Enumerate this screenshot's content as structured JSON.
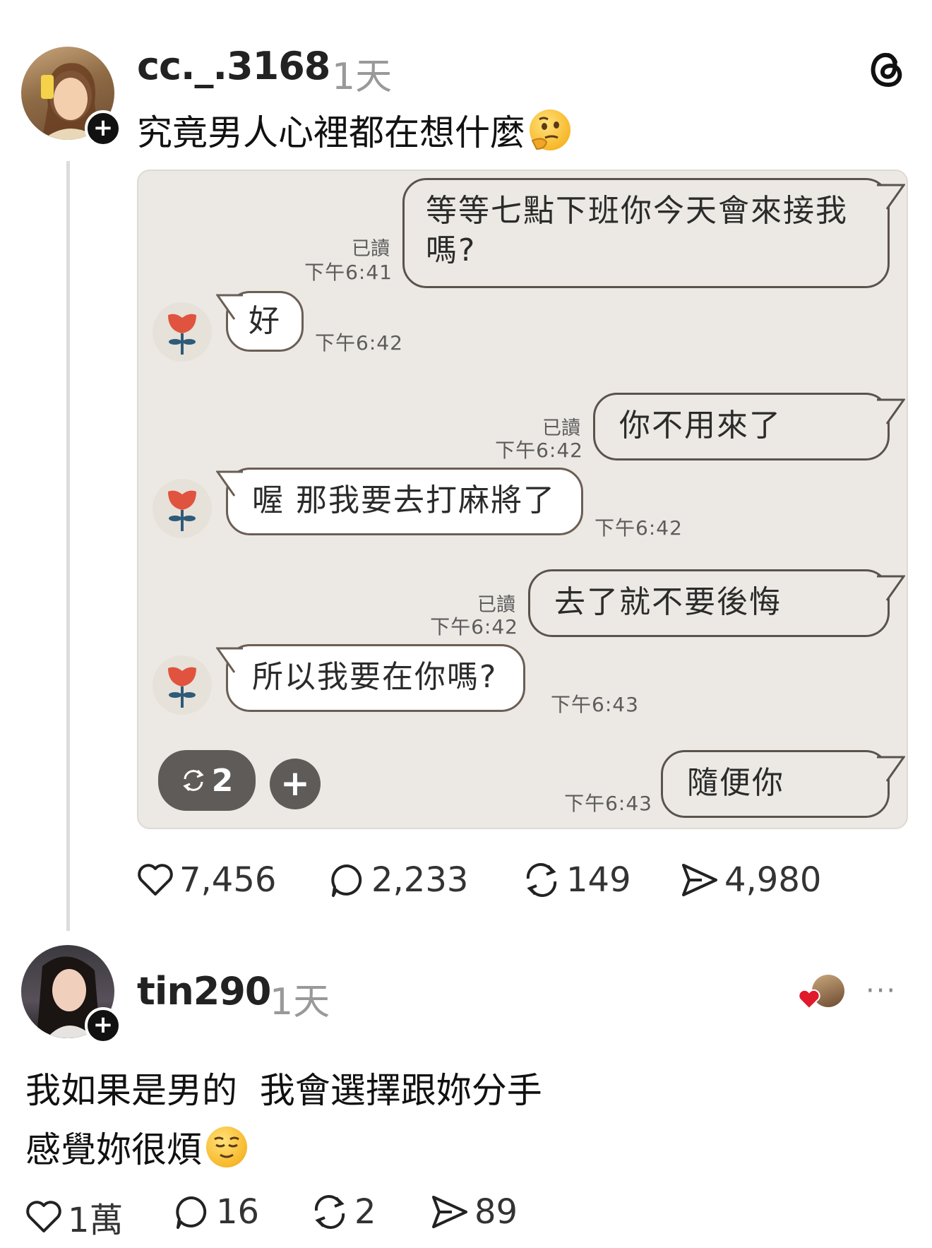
{
  "post": {
    "username": "cc._.3168",
    "time_ago": "1天",
    "text": "究竟男人心裡都在想什麼",
    "emoji_name": "thinking-face",
    "stats": {
      "likes": "7,456",
      "comments": "2,233",
      "reposts": "149",
      "shares": "4,980"
    }
  },
  "chat": {
    "messages": [
      {
        "side": "out",
        "lines": [
          "等等七點下班你今天會來接我",
          "嗎?"
        ],
        "read": "已讀",
        "time": "下午6:41"
      },
      {
        "side": "in",
        "text": "好",
        "time": "下午6:42"
      },
      {
        "side": "out",
        "text": "你不用來了",
        "read": "已讀",
        "time": "下午6:42"
      },
      {
        "side": "in",
        "text": "喔 那我要去打麻將了",
        "time": "下午6:42"
      },
      {
        "side": "out",
        "text": "去了就不要後悔",
        "read": "已讀",
        "time": "下午6:42"
      },
      {
        "side": "in",
        "text": "所以我要在你嗎?",
        "time": "下午6:43"
      },
      {
        "side": "out",
        "text": "隨便你",
        "time": "下午6:43"
      }
    ],
    "repost_count": "2",
    "plus_label": "+"
  },
  "reply": {
    "username": "tin290",
    "time_ago": "1天",
    "line1": "我如果是男的  我會選擇跟妳分手",
    "line2": "感覺妳很煩",
    "emoji_name": "relieved-face",
    "more_label": "···",
    "stats": {
      "likes": "1萬",
      "comments": "16",
      "reposts": "2",
      "shares": "89"
    }
  },
  "colors": {
    "chat_bg": "#ece9e4",
    "tulip_red": "#e0533f",
    "tulip_stem": "#2d5b78",
    "heart_red": "#e0192b"
  }
}
